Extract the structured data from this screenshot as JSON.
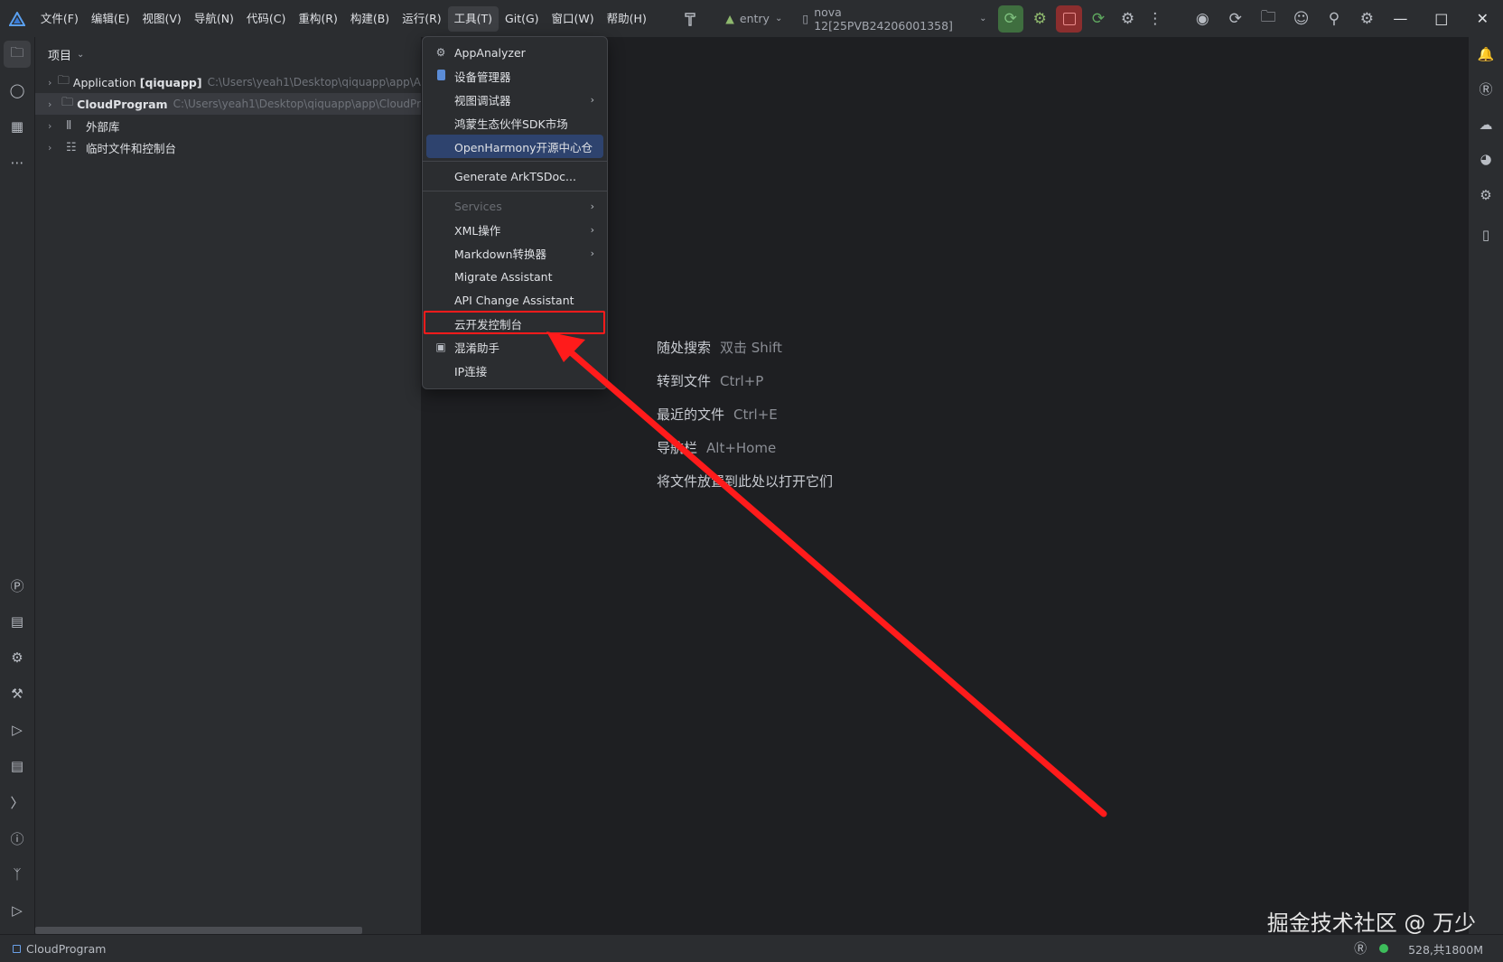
{
  "menubar": {
    "items": [
      "文件(F)",
      "编辑(E)",
      "视图(V)",
      "导航(N)",
      "代码(C)",
      "重构(R)",
      "构建(B)",
      "运行(R)",
      "工具(T)",
      "Git(G)",
      "窗口(W)",
      "帮助(H)"
    ],
    "active_index": 8
  },
  "toolbar": {
    "run_config": "entry",
    "device": "nova 12[25PVB24206001358]"
  },
  "project_panel": {
    "title": "项目",
    "tree": [
      {
        "name": "Application",
        "tag": "[qiquapp]",
        "path": "C:\\Users\\yeah1\\Desktop\\qiquapp\\app\\A",
        "icon": "folder-icon"
      },
      {
        "name": "CloudProgram",
        "tag": "",
        "path": "C:\\Users\\yeah1\\Desktop\\qiquapp\\app\\CloudPr",
        "icon": "folder-icon",
        "selected": true
      },
      {
        "name": "外部库",
        "tag": "",
        "path": "",
        "icon": "library-icon"
      },
      {
        "name": "临时文件和控制台",
        "tag": "",
        "path": "",
        "icon": "scratch-icon"
      }
    ]
  },
  "tools_menu": {
    "items": [
      {
        "label": "AppAnalyzer",
        "icon": "robot-icon"
      },
      {
        "label": "设备管理器",
        "icon": "device-icon"
      },
      {
        "label": "视图调试器",
        "submenu": true
      },
      {
        "label": "鸿蒙生态伙伴SDK市场"
      },
      {
        "label": "OpenHarmony开源中心仓",
        "highlight": true
      },
      {
        "separator": true
      },
      {
        "label": "Generate ArkTSDoc..."
      },
      {
        "separator": true
      },
      {
        "label": "Services",
        "submenu": true,
        "disabled": true
      },
      {
        "label": "XML操作",
        "submenu": true
      },
      {
        "label": "Markdown转换器",
        "submenu": true
      },
      {
        "label": "Migrate Assistant"
      },
      {
        "label": "API Change Assistant"
      },
      {
        "label": "云开发控制台",
        "boxed": true
      },
      {
        "label": "混淆助手",
        "icon": "obfuscate-icon"
      },
      {
        "label": "IP连接"
      }
    ]
  },
  "editor_hints": [
    {
      "label": "随处搜索",
      "key": "双击 Shift"
    },
    {
      "label": "转到文件",
      "key": "Ctrl+P"
    },
    {
      "label": "最近的文件",
      "key": "Ctrl+E"
    },
    {
      "label": "导航栏",
      "key": "Alt+Home"
    },
    {
      "label": "将文件放置到此处以打开它们",
      "key": ""
    }
  ],
  "statusbar": {
    "project": "CloudProgram",
    "memory": "528,共1800M"
  },
  "watermark": "掘金技术社区 @ 万少",
  "colors": {
    "highlight": "#2e436e",
    "annotation_red": "#ff1b1b",
    "run_green": "#3f6e3f",
    "stop_red": "#8b2e2e"
  }
}
